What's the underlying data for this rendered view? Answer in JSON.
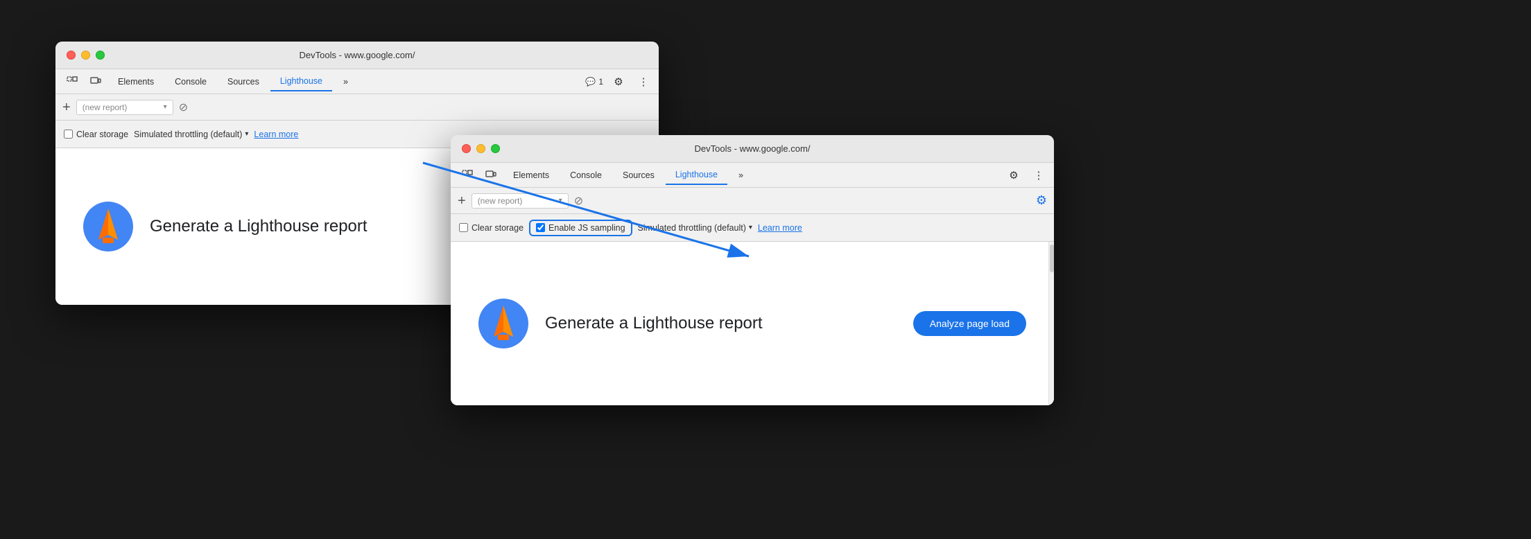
{
  "back_window": {
    "title": "DevTools - www.google.com/",
    "tabs": {
      "icon1": "⬚",
      "icon2": "⬜",
      "elements": "Elements",
      "console": "Console",
      "sources": "Sources",
      "lighthouse": "Lighthouse",
      "more": "»"
    },
    "tab_bar_right": {
      "comment_icon": "💬",
      "comment_count": "1",
      "settings_icon": "⚙",
      "more_icon": "⋮"
    },
    "report_bar": {
      "add": "+",
      "placeholder": "(new report)",
      "chevron": "▾",
      "cancel": "⊘"
    },
    "options_bar": {
      "clear_storage": "Clear storage",
      "throttle": "Simulated throttling (default)",
      "arrow": "▾",
      "learn_more": "Learn more"
    },
    "main": {
      "generate_text": "Generate a Lighthouse report"
    }
  },
  "front_window": {
    "title": "DevTools - www.google.com/",
    "tabs": {
      "icon1": "⬚",
      "icon2": "⬜",
      "elements": "Elements",
      "console": "Console",
      "sources": "Sources",
      "lighthouse": "Lighthouse",
      "more": "»"
    },
    "tab_bar_right": {
      "settings_icon": "⚙",
      "more_icon": "⋮"
    },
    "report_bar": {
      "add": "+",
      "placeholder": "(new report)",
      "chevron": "▾",
      "cancel": "⊘"
    },
    "options_bar": {
      "clear_storage": "Clear storage",
      "enable_js": "Enable JS sampling",
      "throttle": "Simulated throttling (default)",
      "arrow": "▾",
      "learn_more": "Learn more"
    },
    "main": {
      "generate_text": "Generate a Lighthouse report",
      "analyze_btn": "Analyze page load"
    }
  },
  "colors": {
    "blue": "#1a73e8",
    "active_tab": "#1a73e8"
  }
}
